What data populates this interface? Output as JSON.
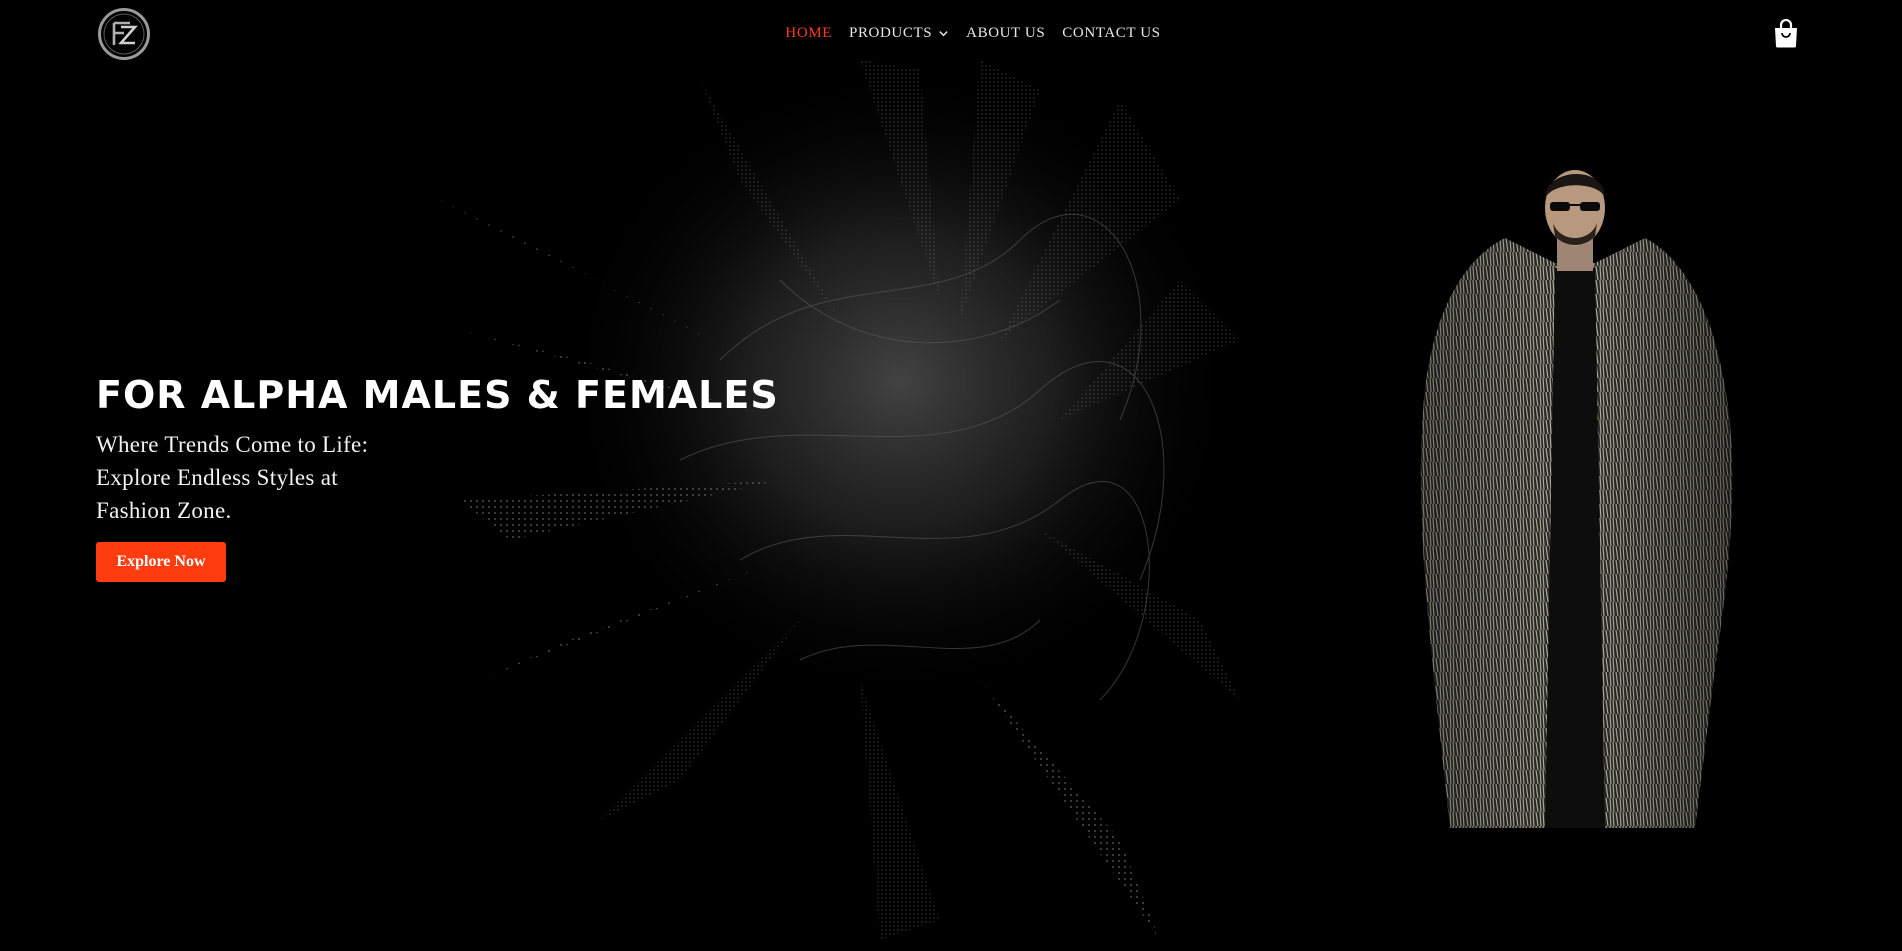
{
  "brand": {
    "logo_text": "FZ",
    "accent": "#ff3c1a"
  },
  "nav": {
    "items": [
      {
        "label": "HOME",
        "active": true
      },
      {
        "label": "PRODUCTS",
        "active": false,
        "has_dropdown": true
      },
      {
        "label": "ABOUT US",
        "active": false
      },
      {
        "label": "CONTACT US",
        "active": false
      }
    ],
    "cart_icon": "shopping-bag-icon",
    "dropdown_icon": "chevron-down-icon"
  },
  "hero": {
    "title": "FOR ALPHA MALES & FEMALES",
    "subtitle": "Where Trends Come to Life: Explore Endless Styles at Fashion Zone.",
    "cta_label": "Explore Now",
    "background_art": "dark particle splash",
    "image_subject": "man in grey fur coat with sunglasses"
  },
  "colors": {
    "background": "#000000",
    "cta": "#ff3c0f",
    "nav_text": "#e8e8e8"
  }
}
